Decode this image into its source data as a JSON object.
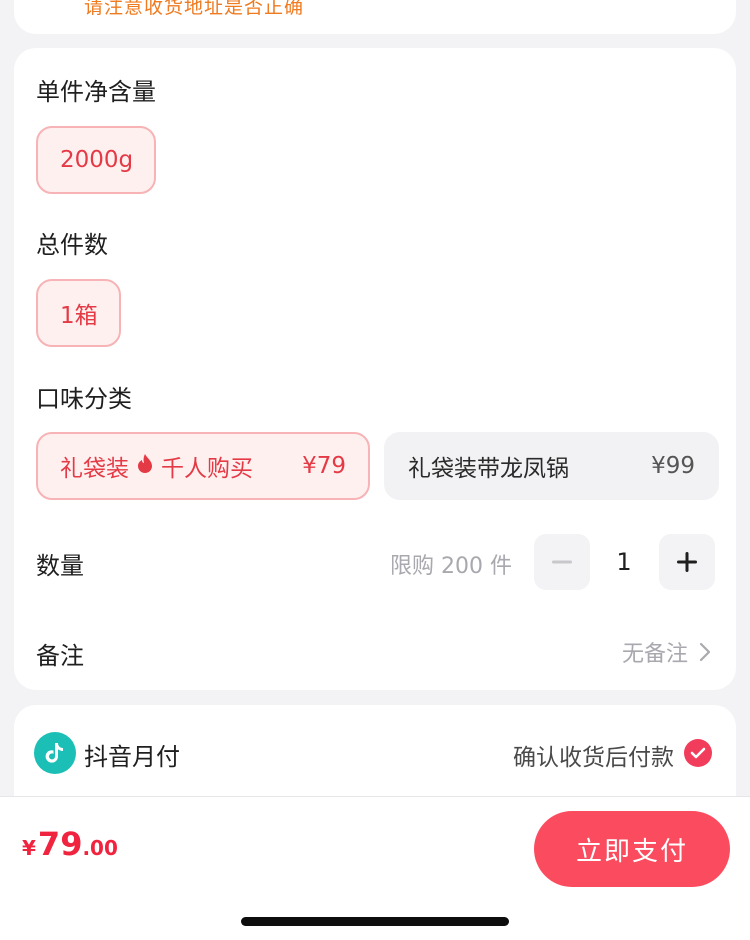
{
  "address_notice": "请注意收货地址是否正确",
  "spec": {
    "weight": {
      "title": "单件净含量",
      "options": [
        "2000g"
      ]
    },
    "count": {
      "title": "总件数",
      "options": [
        "1箱"
      ]
    },
    "flavor": {
      "title": "口味分类",
      "options": [
        {
          "label": "礼袋装",
          "tag": "千人购买",
          "price": "¥79",
          "selected": true
        },
        {
          "label": "礼袋装带龙凤锅",
          "price": "¥99",
          "selected": false
        }
      ]
    }
  },
  "quantity": {
    "label": "数量",
    "limit": "限购 200 件",
    "value": "1"
  },
  "remark": {
    "label": "备注",
    "value": "无备注"
  },
  "payment": {
    "name": "抖音月付",
    "note": "确认收货后付款",
    "checked": true
  },
  "footer": {
    "currency": "¥",
    "price_int": "79",
    "price_dec": ".00",
    "pay_button": "立即支付"
  },
  "colors": {
    "accent": "#fb4c5f",
    "price": "#f0243f",
    "warning": "#ef7a1f",
    "douyin": "#1bbfb6"
  }
}
